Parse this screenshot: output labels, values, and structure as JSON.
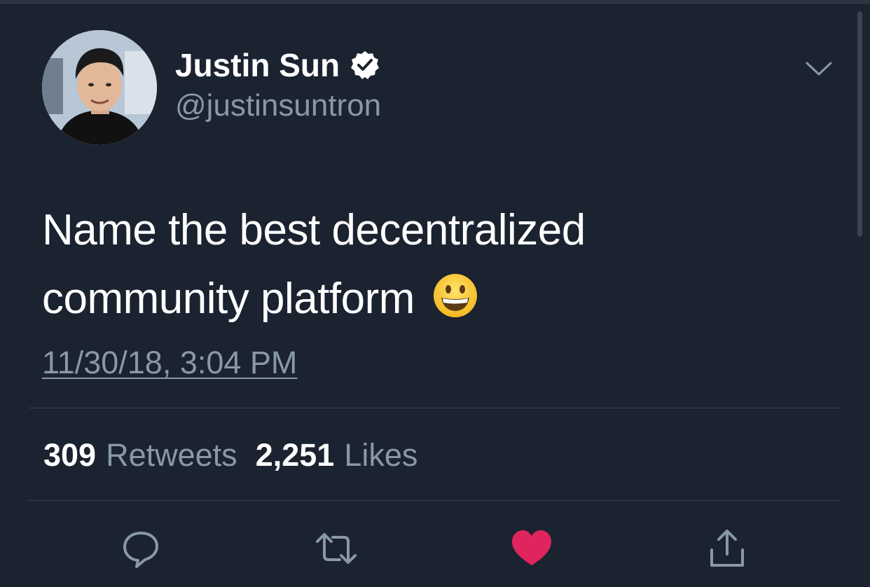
{
  "tweet": {
    "author": {
      "display_name": "Justin Sun",
      "handle": "@justinsuntron",
      "verified": true
    },
    "text": "Name the best decentralized community platform",
    "emoji": "grinning-face",
    "timestamp": "11/30/18, 3:04 PM",
    "stats": {
      "retweets_count": "309",
      "retweets_label": "Retweets",
      "likes_count": "2,251",
      "likes_label": "Likes"
    },
    "liked": true
  },
  "icons": {
    "menu": "chevron-down-icon",
    "verified": "verified-badge-icon",
    "reply": "speech-bubble-icon",
    "retweet": "retweet-arrows-icon",
    "like": "heart-icon",
    "share": "share-upload-icon"
  },
  "colors": {
    "background": "#1b2230",
    "text_primary": "#ffffff",
    "text_secondary": "#8899a6",
    "divider": "#38444d",
    "like_active": "#e0245e"
  }
}
